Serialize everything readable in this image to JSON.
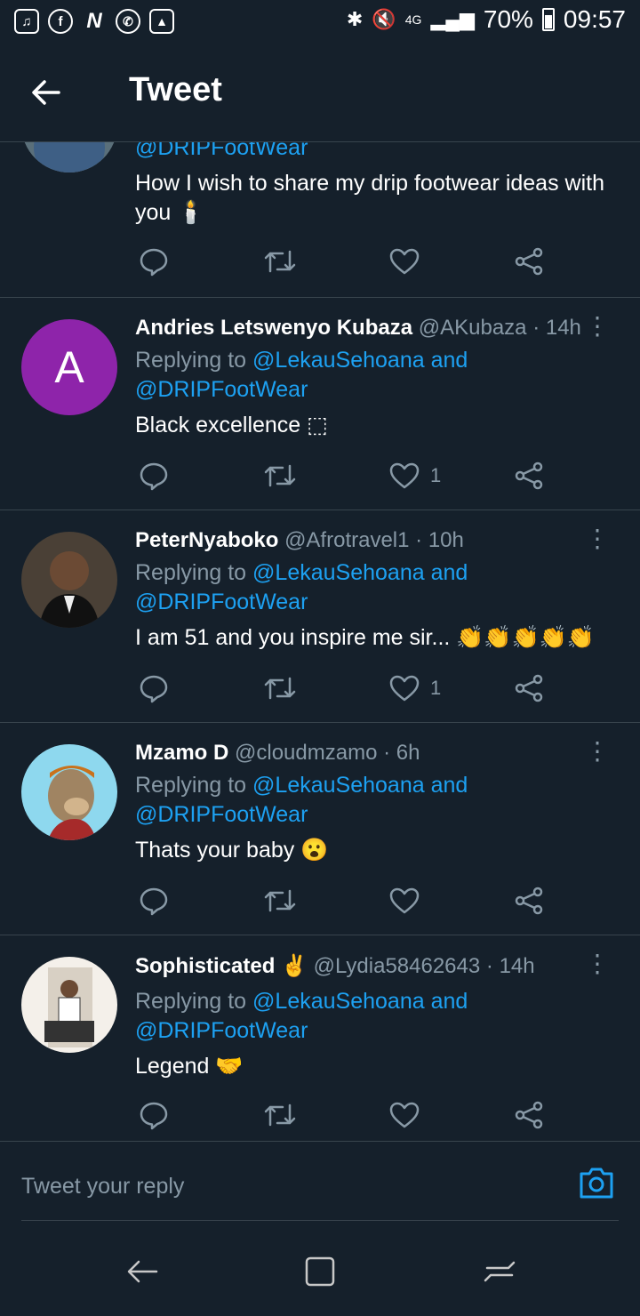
{
  "status_bar": {
    "left_icons": [
      "music-icon",
      "facebook-icon",
      "n-app-icon",
      "whatsapp-icon",
      "gallery-icon"
    ],
    "network": "4G",
    "battery": "70%",
    "time": "09:57"
  },
  "header": {
    "title": "Tweet"
  },
  "tweets": [
    {
      "handle_line": "@DRIPFootWear",
      "text": "How I wish to share my drip footwear ideas with you 🕯️"
    },
    {
      "name": "Andries Letswenyo Kubaza",
      "handle": "@AKubaza",
      "time": "· 14h",
      "avatar_letter": "A",
      "replying_prefix": "Replying to",
      "replying_users": "@LekauSehoana and",
      "replying_users2": "@DRIPFootWear",
      "text": "Black excellence ⬚",
      "likes": "1"
    },
    {
      "name": "PeterNyaboko",
      "handle": "@Afrotravel1",
      "time": "· 10h",
      "replying_prefix": "Replying to",
      "replying_users": "@LekauSehoana and",
      "replying_users2": "@DRIPFootWear",
      "text": "I am 51 and you inspire me sir... 👏👏👏👏👏",
      "likes": "1"
    },
    {
      "name": "Mzamo D",
      "handle": "@cloudmzamo",
      "time": "· 6h",
      "replying_prefix": "Replying to",
      "replying_users": "@LekauSehoana and",
      "replying_users2": "@DRIPFootWear",
      "text": "Thats your baby 😮"
    },
    {
      "name": "Sophisticated ✌️",
      "handle": "@Lydia58462643",
      "time": "· 14h",
      "replying_prefix": "Replying to",
      "replying_users": "@LekauSehoana and",
      "replying_users2": "@DRIPFootWear",
      "text": "Legend 🤝"
    }
  ],
  "reply_box": {
    "placeholder": "Tweet your reply"
  },
  "colors": {
    "background": "#15202b",
    "link": "#1da1f2",
    "muted": "#8899a6",
    "divider": "#38444d",
    "avatar_purple": "#8e24aa"
  }
}
